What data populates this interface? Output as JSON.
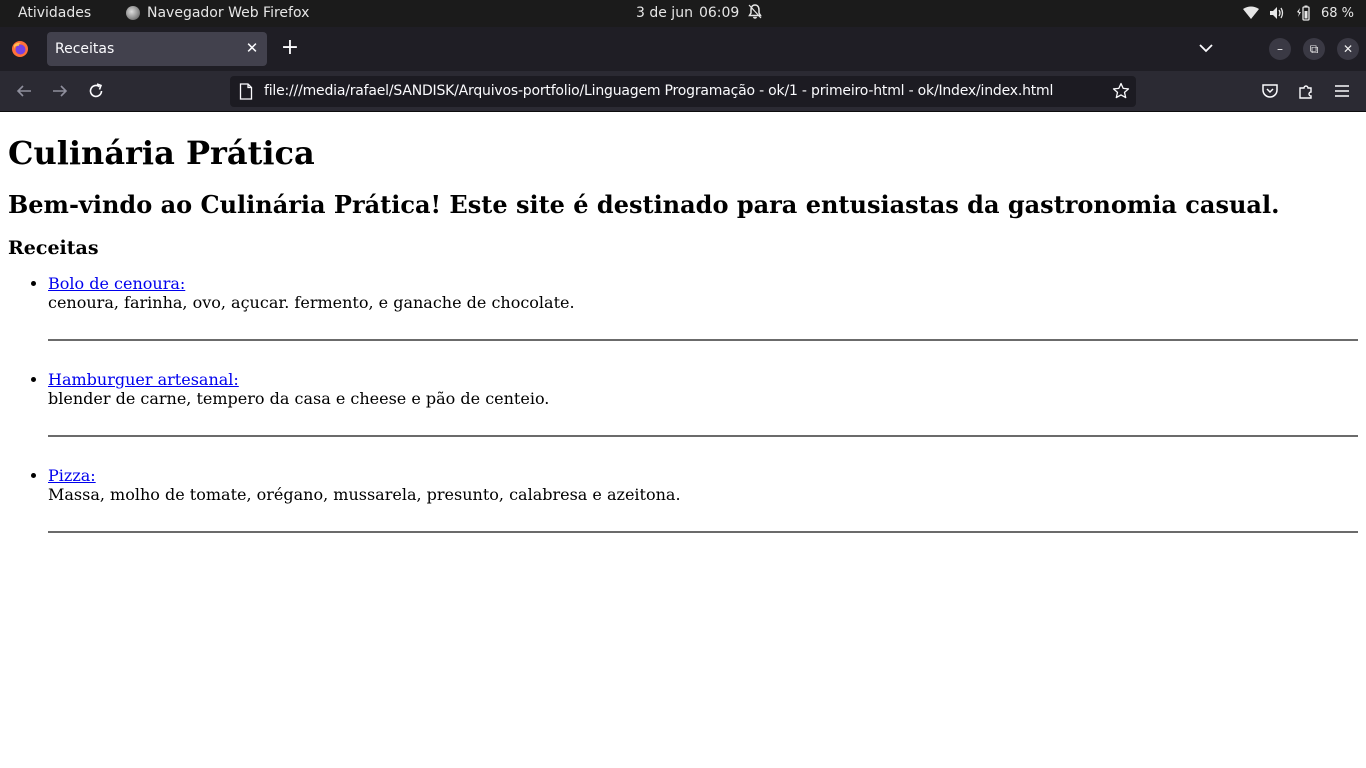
{
  "system_bar": {
    "activities": "Atividades",
    "app_name": "Navegador Web Firefox",
    "date": "3 de jun",
    "time": "06:09",
    "battery": "68 %"
  },
  "browser": {
    "tab_title": "Receitas",
    "url": "file:///media/rafael/SANDISK/Arquivos-portfolio/Linguagem Programação - ok/1 - primeiro-html - ok/Index/index.html"
  },
  "page": {
    "title": "Culinária Prática",
    "subtitle": "Bem-vindo ao Culinária Prática! Este site é destinado para entusiastas da gastronomia casual.",
    "section_heading": "Receitas",
    "recipes": [
      {
        "name": "Bolo de cenoura:",
        "ingredients": "cenoura, farinha, ovo, açucar. fermento, e ganache de chocolate."
      },
      {
        "name": "Hamburguer artesanal:",
        "ingredients": "blender de carne, tempero da casa e cheese e pão de centeio."
      },
      {
        "name": "Pizza:",
        "ingredients": "Massa, molho de tomate, orégano, mussarela, presunto, calabresa e azeitona."
      }
    ]
  },
  "colors": {
    "link": "#0000ee",
    "topbar_bg": "#1b1b1b",
    "tabstrip_bg": "#1f1e25",
    "navbar_bg": "#2b2a33",
    "urlbar_bg": "#1c1b22"
  }
}
